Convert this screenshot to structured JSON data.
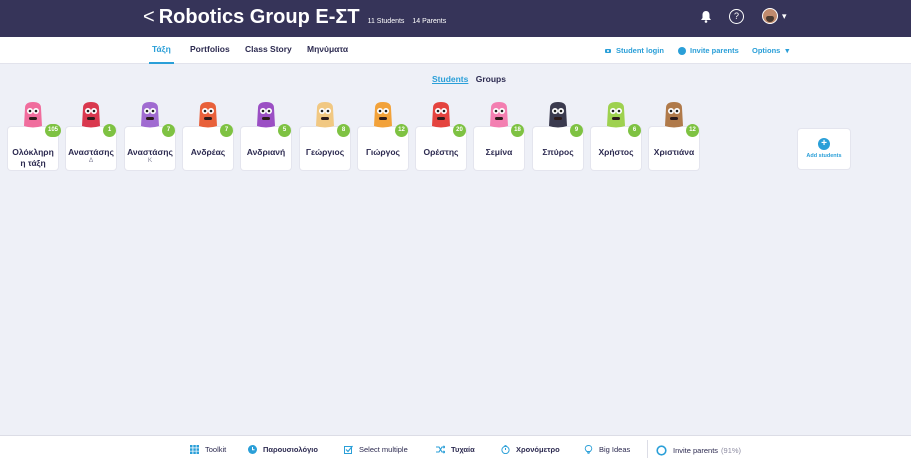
{
  "header": {
    "back_glyph": "<",
    "title": "Robotics Group Ε-ΣΤ",
    "students_count": "11 Students",
    "parents_count": "14 Parents"
  },
  "tabs": [
    {
      "label": "Τάξη",
      "active": true
    },
    {
      "label": "Portfolios",
      "active": false
    },
    {
      "label": "Class Story",
      "active": false
    },
    {
      "label": "Μηνύματα",
      "active": false
    }
  ],
  "toolbar_links": {
    "student_login": "Student login",
    "invite_parents": "Invite parents",
    "options": "Options"
  },
  "view_toggle": {
    "students": "Students",
    "groups": "Groups"
  },
  "students": [
    {
      "name": "Ολόκληρη",
      "name2": "η τάξη",
      "sub": "",
      "points": "105",
      "color": "#f06d9d"
    },
    {
      "name": "Αναστάσης",
      "name2": "",
      "sub": "Δ",
      "points": "1",
      "color": "#d9384e"
    },
    {
      "name": "Αναστάσης",
      "name2": "",
      "sub": "Κ",
      "points": "7",
      "color": "#a06bd1"
    },
    {
      "name": "Ανδρέας",
      "name2": "",
      "sub": "",
      "points": "7",
      "color": "#e8603a"
    },
    {
      "name": "Ανδριανή",
      "name2": "",
      "sub": "",
      "points": "5",
      "color": "#9b4fc4"
    },
    {
      "name": "Γεώργιος",
      "name2": "",
      "sub": "",
      "points": "8",
      "color": "#f1c882"
    },
    {
      "name": "Γιώργος",
      "name2": "",
      "sub": "",
      "points": "12",
      "color": "#f2a23a"
    },
    {
      "name": "Ορέστης",
      "name2": "",
      "sub": "",
      "points": "20",
      "color": "#e4443f"
    },
    {
      "name": "Σεμίνα",
      "name2": "",
      "sub": "",
      "points": "18",
      "color": "#f37fb1"
    },
    {
      "name": "Σπύρος",
      "name2": "",
      "sub": "",
      "points": "9",
      "color": "#3a3a4e"
    },
    {
      "name": "Χρήστος",
      "name2": "",
      "sub": "",
      "points": "6",
      "color": "#9ed14f"
    },
    {
      "name": "Χριστιάνα",
      "name2": "",
      "sub": "",
      "points": "12",
      "color": "#b07a4a"
    }
  ],
  "add_students_label": "Add students",
  "bottom_bar": {
    "toolkit": "Toolkit",
    "attendance": "Παρουσιολόγιο",
    "select_multiple": "Select multiple",
    "random": "Τυχαία",
    "timer": "Χρονόμετρο",
    "big_ideas": "Big Ideas",
    "invite_parents": "Invite parents",
    "invite_percent": "(91%)"
  },
  "colors": {
    "header_bg": "#363459",
    "accent": "#2a9fd8",
    "points_badge": "#7ec242",
    "page_bg": "#eef0f7"
  }
}
